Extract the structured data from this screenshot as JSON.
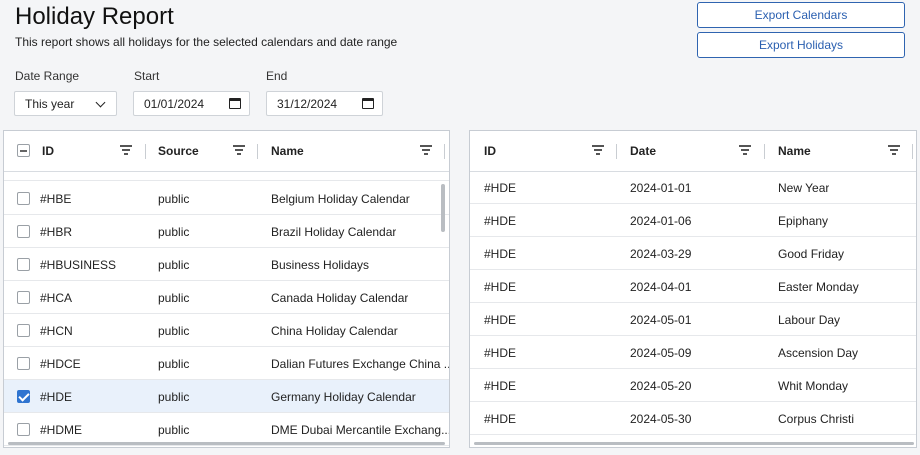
{
  "header": {
    "title": "Holiday Report",
    "subtitle": "This report shows all holidays for the selected calendars and date range"
  },
  "actions": {
    "export_calendars": "Export Calendars",
    "export_holidays": "Export Holidays"
  },
  "filters": {
    "date_range_label": "Date Range",
    "date_range_value": "This year",
    "start_label": "Start",
    "start_value": "01/01/2024",
    "end_label": "End",
    "end_value": "31/12/2024"
  },
  "calendars_grid": {
    "columns": [
      "ID",
      "Source",
      "Name"
    ],
    "rows": [
      {
        "id": "#HBE",
        "source": "public",
        "name": "Belgium Holiday Calendar",
        "checked": false
      },
      {
        "id": "#HBR",
        "source": "public",
        "name": "Brazil Holiday Calendar",
        "checked": false
      },
      {
        "id": "#HBUSINESS",
        "source": "public",
        "name": "Business Holidays",
        "checked": false
      },
      {
        "id": "#HCA",
        "source": "public",
        "name": "Canada Holiday Calendar",
        "checked": false
      },
      {
        "id": "#HCN",
        "source": "public",
        "name": "China Holiday Calendar",
        "checked": false
      },
      {
        "id": "#HDCE",
        "source": "public",
        "name": "Dalian Futures Exchange China ...",
        "checked": false
      },
      {
        "id": "#HDE",
        "source": "public",
        "name": "Germany Holiday Calendar",
        "checked": true
      },
      {
        "id": "#HDME",
        "source": "public",
        "name": "DME Dubai Mercantile Exchang...",
        "checked": false
      }
    ]
  },
  "holidays_grid": {
    "columns": [
      "ID",
      "Date",
      "Name"
    ],
    "rows": [
      {
        "id": "#HDE",
        "date": "2024-01-01",
        "name": "New Year"
      },
      {
        "id": "#HDE",
        "date": "2024-01-06",
        "name": "Epiphany"
      },
      {
        "id": "#HDE",
        "date": "2024-03-29",
        "name": "Good Friday"
      },
      {
        "id": "#HDE",
        "date": "2024-04-01",
        "name": "Easter Monday"
      },
      {
        "id": "#HDE",
        "date": "2024-05-01",
        "name": "Labour Day"
      },
      {
        "id": "#HDE",
        "date": "2024-05-09",
        "name": "Ascension Day"
      },
      {
        "id": "#HDE",
        "date": "2024-05-20",
        "name": "Whit Monday"
      },
      {
        "id": "#HDE",
        "date": "2024-05-30",
        "name": "Corpus Christi"
      }
    ]
  },
  "colors": {
    "accent": "#2f74d0",
    "button_border": "#2f64b0",
    "selected_row": "#e9f1fb"
  }
}
